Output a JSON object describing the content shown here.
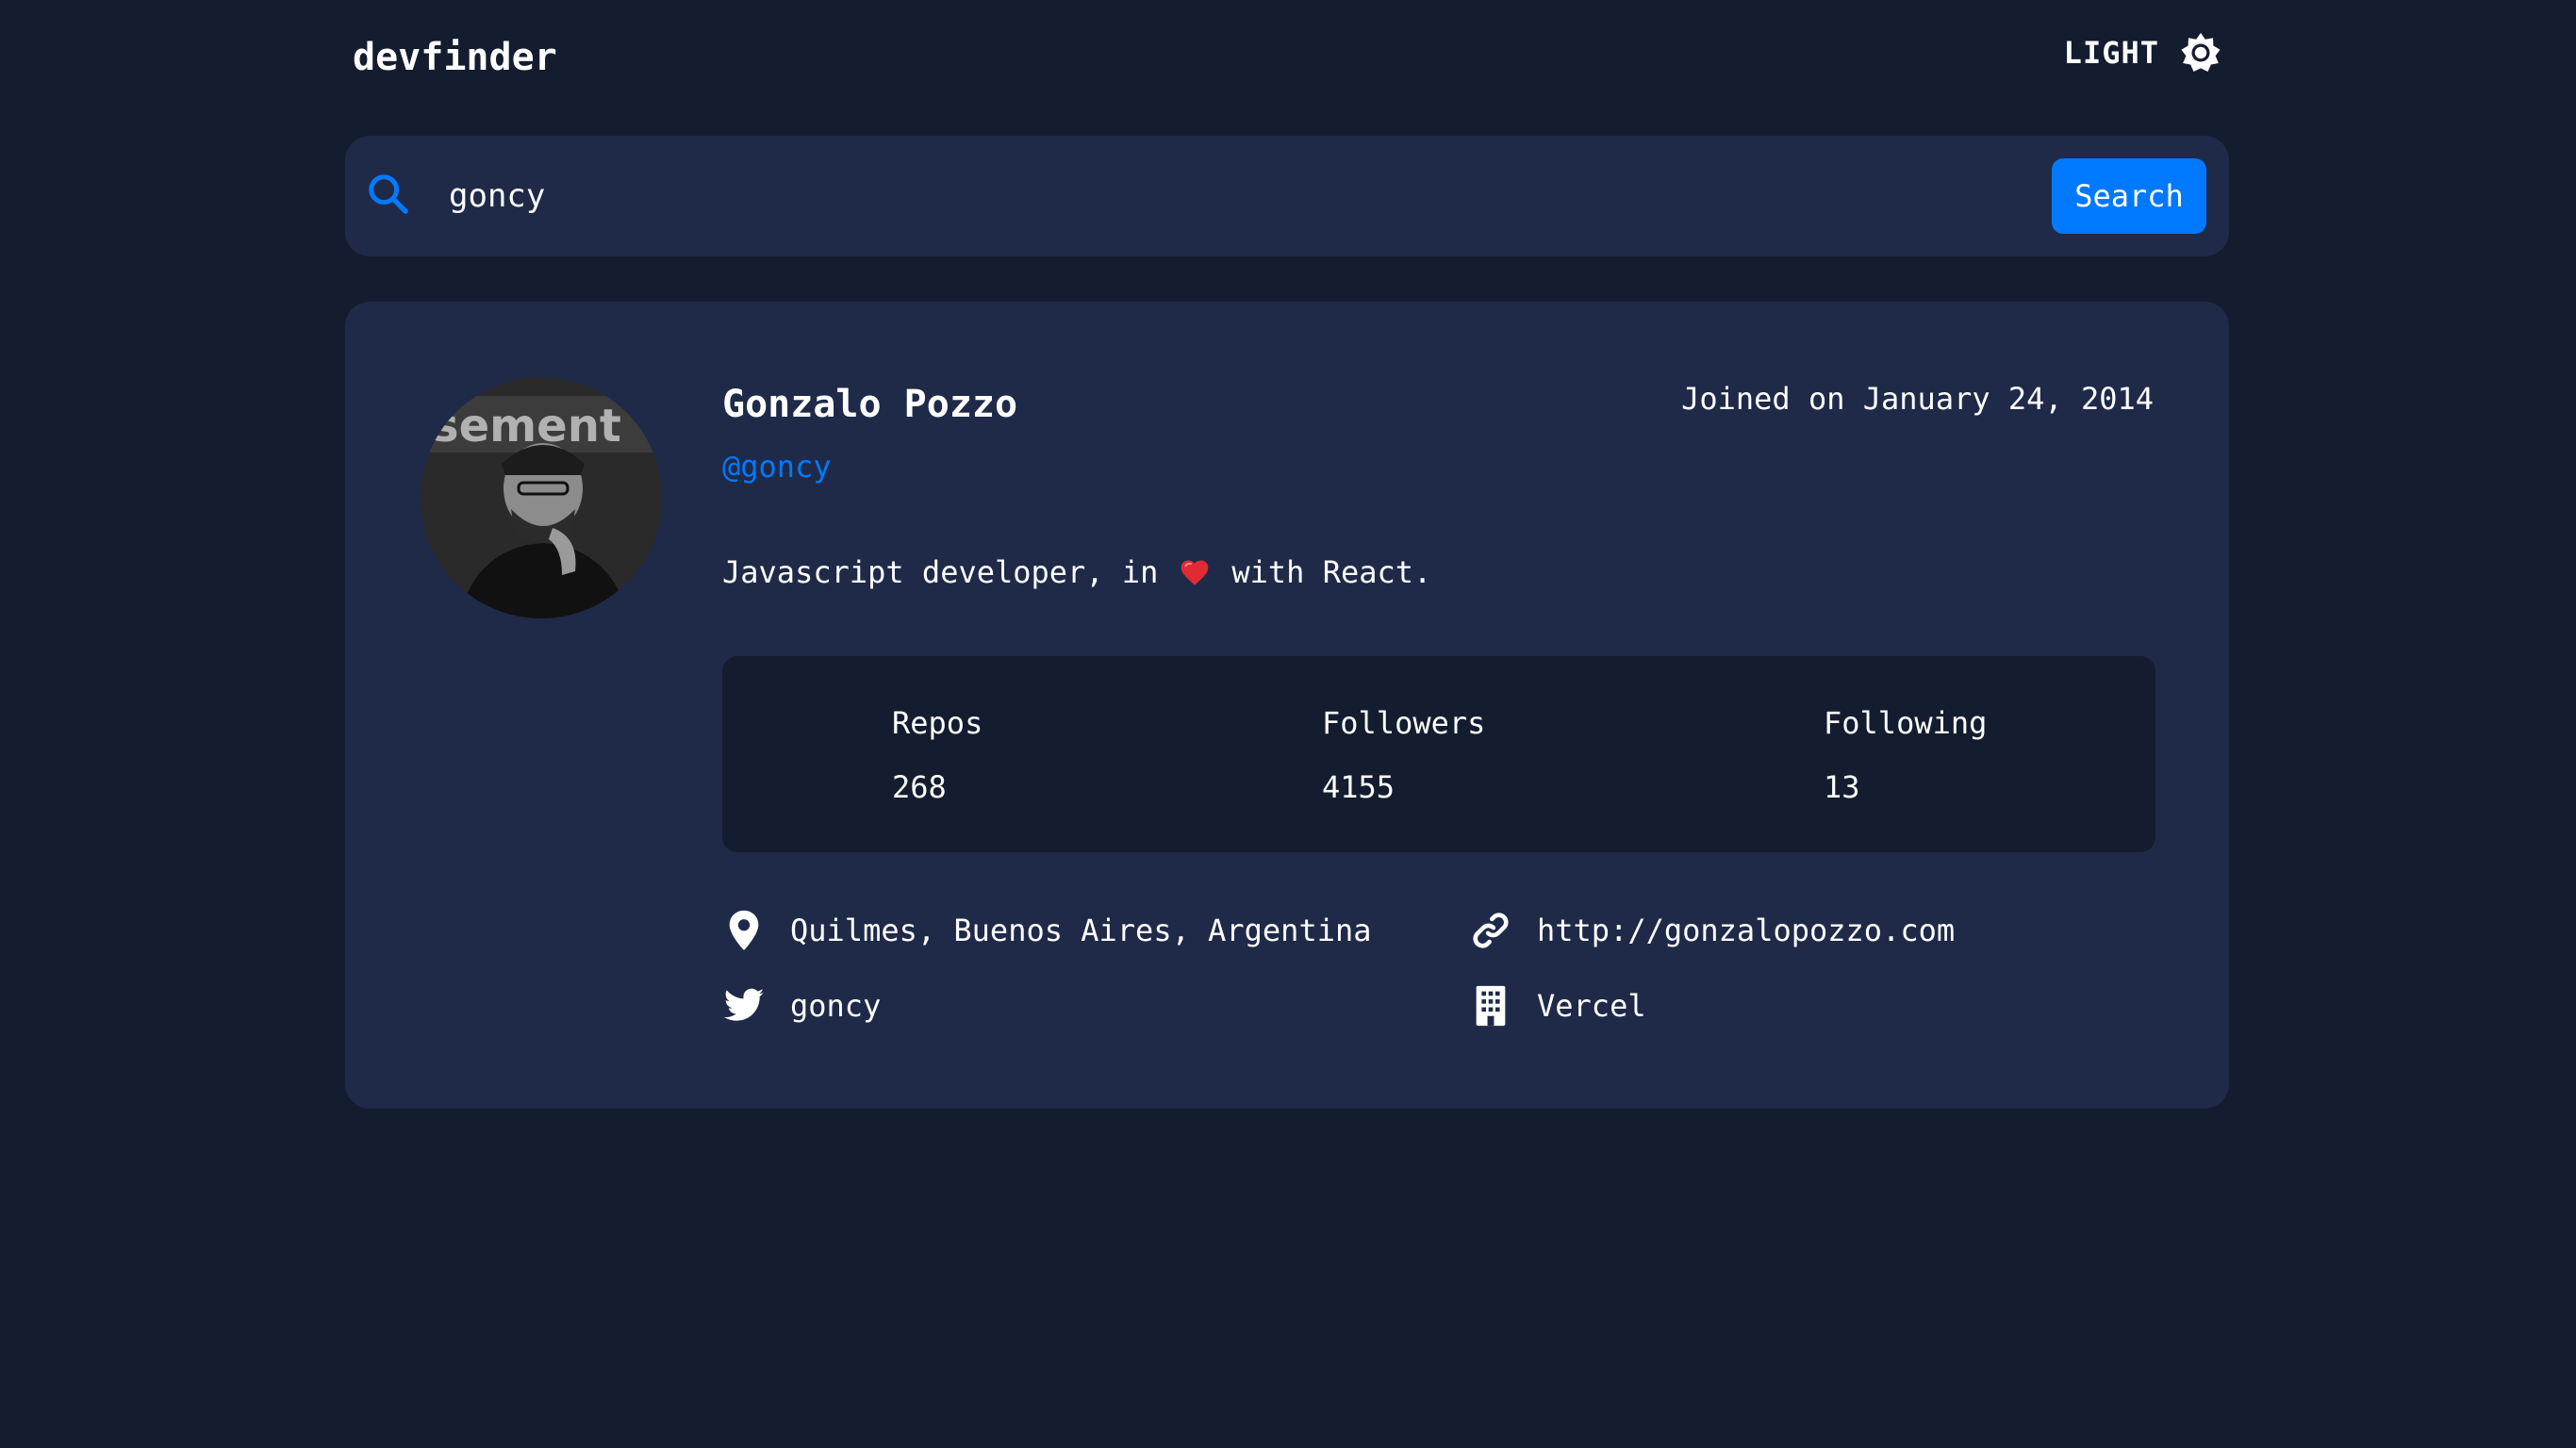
{
  "app": {
    "logo": "devfinder",
    "theme_label": "LIGHT"
  },
  "search": {
    "value": "goncy",
    "placeholder": "",
    "button_label": "Search"
  },
  "profile": {
    "name": "Gonzalo Pozzo",
    "login": "@goncy",
    "joined": "Joined on January 24, 2014",
    "bio_before": "Javascript developer, in",
    "bio_after": "with React.",
    "stats": [
      {
        "label": "Repos",
        "value": "268"
      },
      {
        "label": "Followers",
        "value": "4155"
      },
      {
        "label": "Following",
        "value": "13"
      }
    ],
    "location": "Quilmes, Buenos Aires, Argentina",
    "blog": "http://gonzalopozzo.com",
    "twitter": "goncy",
    "company": "Vercel"
  },
  "colors": {
    "background": "#141c2f",
    "card": "#1f2a48",
    "accent": "#0079ff",
    "text": "#ffffff",
    "heart": "#e02b35"
  },
  "icons": [
    "sun-icon",
    "search-icon",
    "heart-icon",
    "location-icon",
    "link-icon",
    "twitter-icon",
    "company-icon"
  ]
}
